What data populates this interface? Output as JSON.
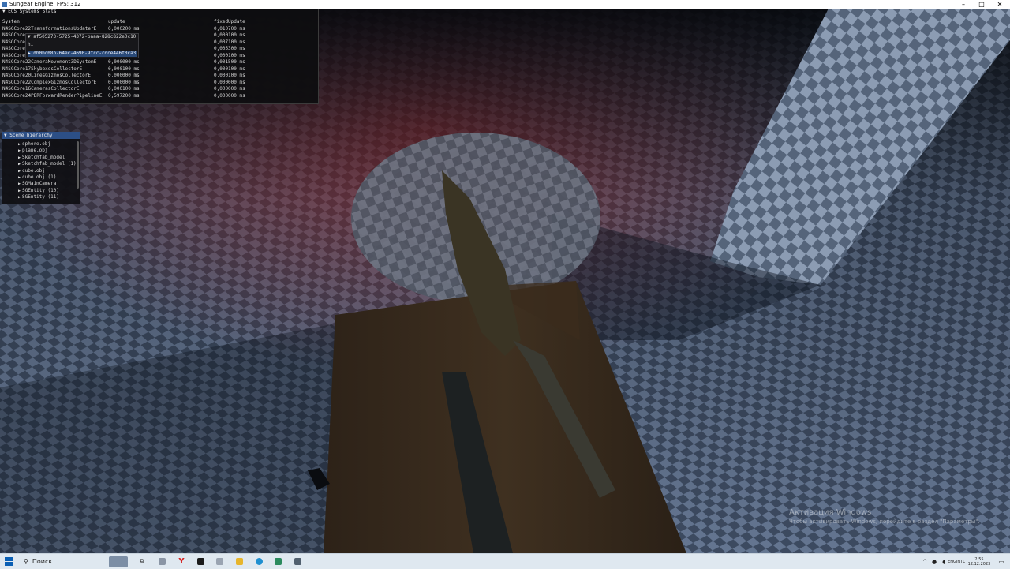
{
  "window": {
    "title": "Sungear Engine. FPS: 312"
  },
  "ecs_panel": {
    "header": "ECS Systems Stats",
    "columns": [
      "System",
      "update",
      "fixedUpdate"
    ],
    "rows": [
      {
        "system": "N4SGCore22TransformationsUpdaterE",
        "update": "0,000200 ms",
        "fixed": "0,010700 ms"
      },
      {
        "system": "N4SGCore",
        "update": "",
        "fixed": "0,000100 ms"
      },
      {
        "system": "N4SGCore",
        "update": "",
        "fixed": "0,007100 ms"
      },
      {
        "system": "N4SGCore",
        "update": "",
        "fixed": "0,005300 ms"
      },
      {
        "system": "N4SGCore",
        "update": "",
        "fixed": "0,000100 ms"
      },
      {
        "system": "N4SGCore22CameraMovement3DSystemE",
        "update": "0,000000 ms",
        "fixed": "0,001500 ms"
      },
      {
        "system": "N4SGCore17SkyboxesCollectorE",
        "update": "0,000100 ms",
        "fixed": "0,000100 ms"
      },
      {
        "system": "N4SGCore20LinesGizmosCollectorE",
        "update": "0,000000 ms",
        "fixed": "0,000100 ms"
      },
      {
        "system": "N4SGCore22ComplexGizmosCollectorE",
        "update": "0,000000 ms",
        "fixed": "0,000000 ms"
      },
      {
        "system": "N4SGCore16CamerasCollectorE",
        "update": "0,000100 ms",
        "fixed": "0,000000 ms"
      },
      {
        "system": "N4SGCore24PBRForwardRenderPipelineE",
        "update": "0,597200 ms",
        "fixed": "0,000000 ms"
      }
    ]
  },
  "popup": {
    "uuid": "af505273-5725-4372-baaa-828c822e0c10",
    "label": "hi",
    "selected": "db0bc08b-64ec-4690-9fcc-cdce446f0ca3"
  },
  "scene_hierarchy": {
    "title": "Scene hierarchy",
    "items": [
      "sphere.obj",
      "plane.obj",
      "Sketchfab_model",
      "Sketchfab_model (1)",
      "cube.obj",
      "cube.obj (1)",
      "SGMainCamera",
      "SGEntity (10)",
      "SGEntity (11)"
    ]
  },
  "activation": {
    "title": "Активация Windows",
    "subtitle": "Чтобы активировать Windows, перейдите в раздел \"Параметры\"."
  },
  "taskbar": {
    "search_placeholder": "Поиск",
    "lang": "ENG",
    "layout": "INTL",
    "time": "2:55",
    "date": "12.12.2023"
  }
}
